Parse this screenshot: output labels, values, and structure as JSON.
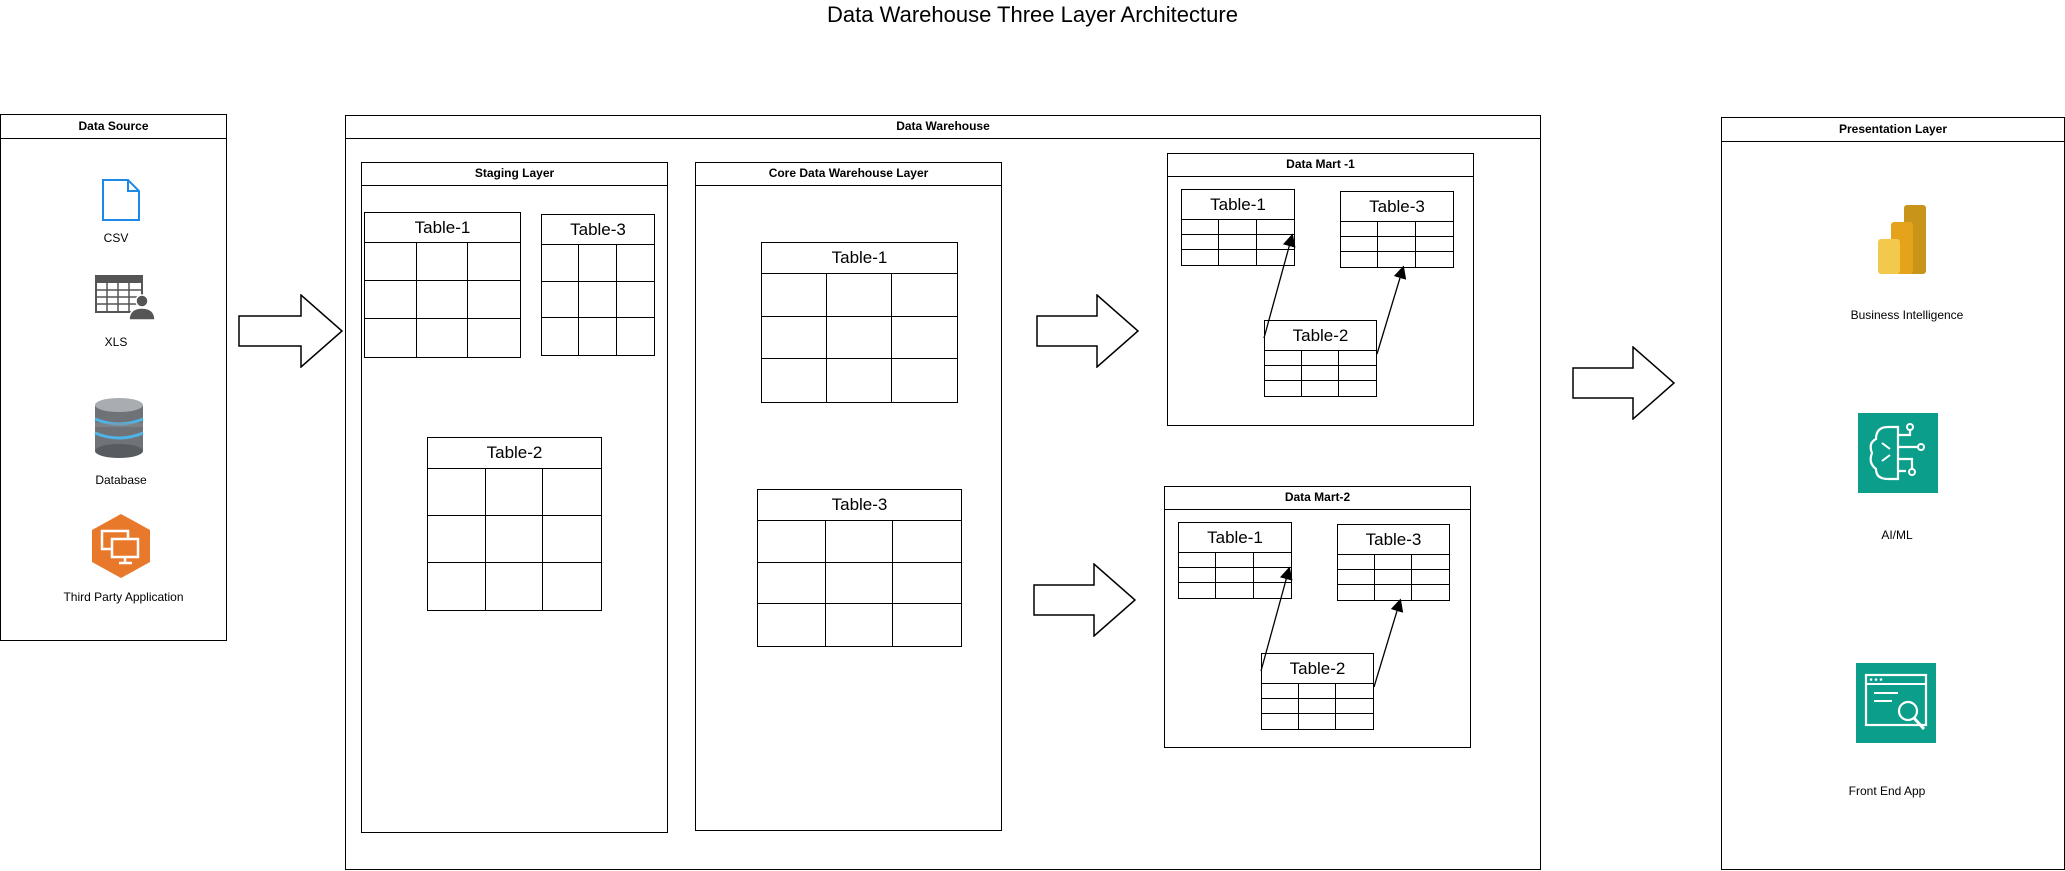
{
  "title": "Data Warehouse Three Layer Architecture",
  "data_source": {
    "header": "Data Source",
    "items": [
      {
        "label": "CSV",
        "icon": "file-icon"
      },
      {
        "label": "XLS",
        "icon": "spreadsheet-user-icon"
      },
      {
        "label": "Database",
        "icon": "database-icon"
      },
      {
        "label": "Third Party Application",
        "icon": "third-party-app-icon"
      }
    ]
  },
  "warehouse": {
    "header": "Data Warehouse",
    "staging": {
      "header": "Staging Layer",
      "tables": [
        "Table-1",
        "Table-3",
        "Table-2"
      ]
    },
    "core": {
      "header": "Core Data Warehouse Layer",
      "tables": [
        "Table-1",
        "Table-3"
      ]
    },
    "mart1": {
      "header": "Data Mart -1",
      "tables": [
        "Table-1",
        "Table-3",
        "Table-2"
      ]
    },
    "mart2": {
      "header": "Data Mart-2",
      "tables": [
        "Table-1",
        "Table-3",
        "Table-2"
      ]
    }
  },
  "presentation": {
    "header": "Presentation Layer",
    "items": [
      {
        "label": "Business Intelligence",
        "icon": "power-bi-icon"
      },
      {
        "label": "AI/ML",
        "icon": "ai-ml-icon"
      },
      {
        "label": "Front End App",
        "icon": "front-end-app-icon"
      }
    ]
  },
  "colors": {
    "csv": "#1e88e5",
    "orange": "#e8782a",
    "teal": "#0b9f8b",
    "gold": "#e5a31c",
    "grey": "#555555"
  }
}
